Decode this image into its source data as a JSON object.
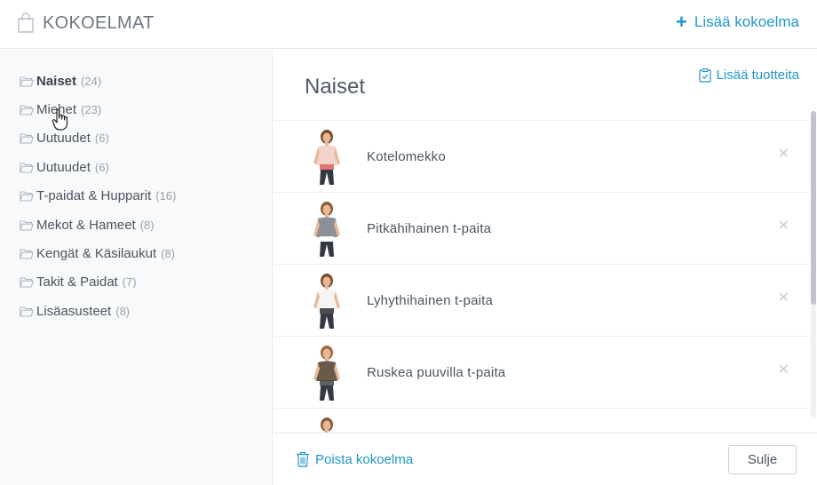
{
  "header": {
    "icon": "shopping-bag-icon",
    "title": "KOKOELMAT",
    "add_collection_label": "Lisää kokoelma",
    "accent_color": "#2196c9"
  },
  "sidebar": {
    "items": [
      {
        "label": "Naiset",
        "count": "(24)",
        "active": true
      },
      {
        "label": "Miehet",
        "count": "(23)",
        "active": false
      },
      {
        "label": "Uutuudet",
        "count": "(6)",
        "active": false
      },
      {
        "label": "Uutuudet",
        "count": "(6)",
        "active": false
      },
      {
        "label": "T-paidat & Hupparit",
        "count": "(16)",
        "active": false
      },
      {
        "label": "Mekot & Hameet",
        "count": "(8)",
        "active": false
      },
      {
        "label": "Kengät & Käsilaukut",
        "count": "(8)",
        "active": false
      },
      {
        "label": "Takit & Paidat",
        "count": "(7)",
        "active": false
      },
      {
        "label": "Lisäasusteet",
        "count": "(8)",
        "active": false
      }
    ]
  },
  "main": {
    "title": "Naiset",
    "add_products_label": "Lisää tuotteita",
    "products": [
      {
        "name": "Kotelomekko"
      },
      {
        "name": "Pitkähihainen t-paita"
      },
      {
        "name": "Lyhythihainen t-paita"
      },
      {
        "name": "Ruskea puuvilla t-paita"
      }
    ]
  },
  "footer": {
    "delete_label": "Poista kokoelma",
    "close_label": "Sulje"
  }
}
